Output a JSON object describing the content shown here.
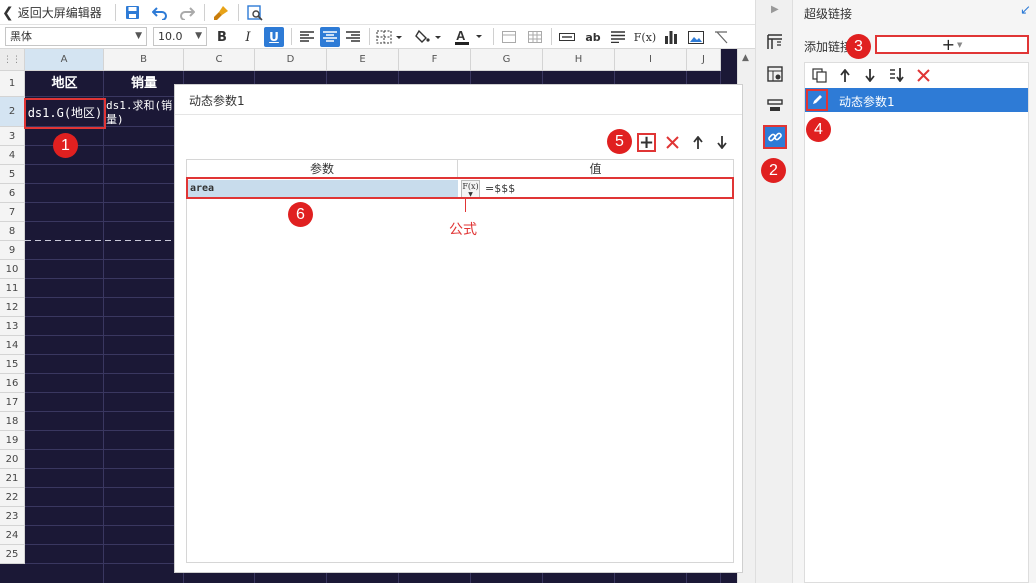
{
  "toolbar": {
    "back_label": "返回大屏编辑器",
    "font_name": "黑体",
    "font_size": "10.0",
    "bold": "B",
    "italic": "I",
    "underline": "U",
    "fx_label": "F(x)",
    "ab_label": "ab"
  },
  "sheet": {
    "columns": [
      "A",
      "B",
      "C",
      "D",
      "E",
      "F",
      "G",
      "H",
      "I",
      "J"
    ],
    "rows": [
      "1",
      "2",
      "3",
      "4",
      "5",
      "6",
      "7",
      "8",
      "9",
      "10",
      "11",
      "12",
      "13",
      "14",
      "15",
      "16",
      "17",
      "18",
      "19",
      "20",
      "21",
      "22",
      "23",
      "24",
      "25"
    ],
    "header_region": "地区",
    "header_sales": "销量",
    "cell_a2": "ds1.G(地区)",
    "cell_b2": "ds1.求和(销量)"
  },
  "dialog": {
    "title": "动态参数1",
    "col_param": "参数",
    "col_value": "值",
    "param_name": "area",
    "fx_glyph": "F(x)",
    "param_value": "=$$$",
    "formula_label": "公式"
  },
  "right_panel": {
    "title": "超级链接",
    "add_link_label": "添加链接",
    "link_item": "动态参数1"
  },
  "callouts": [
    "1",
    "2",
    "3",
    "4",
    "5",
    "6"
  ],
  "colors": {
    "accent": "#2e7bd6",
    "callout": "#e02020",
    "sheet_bg": "#1b1836"
  }
}
